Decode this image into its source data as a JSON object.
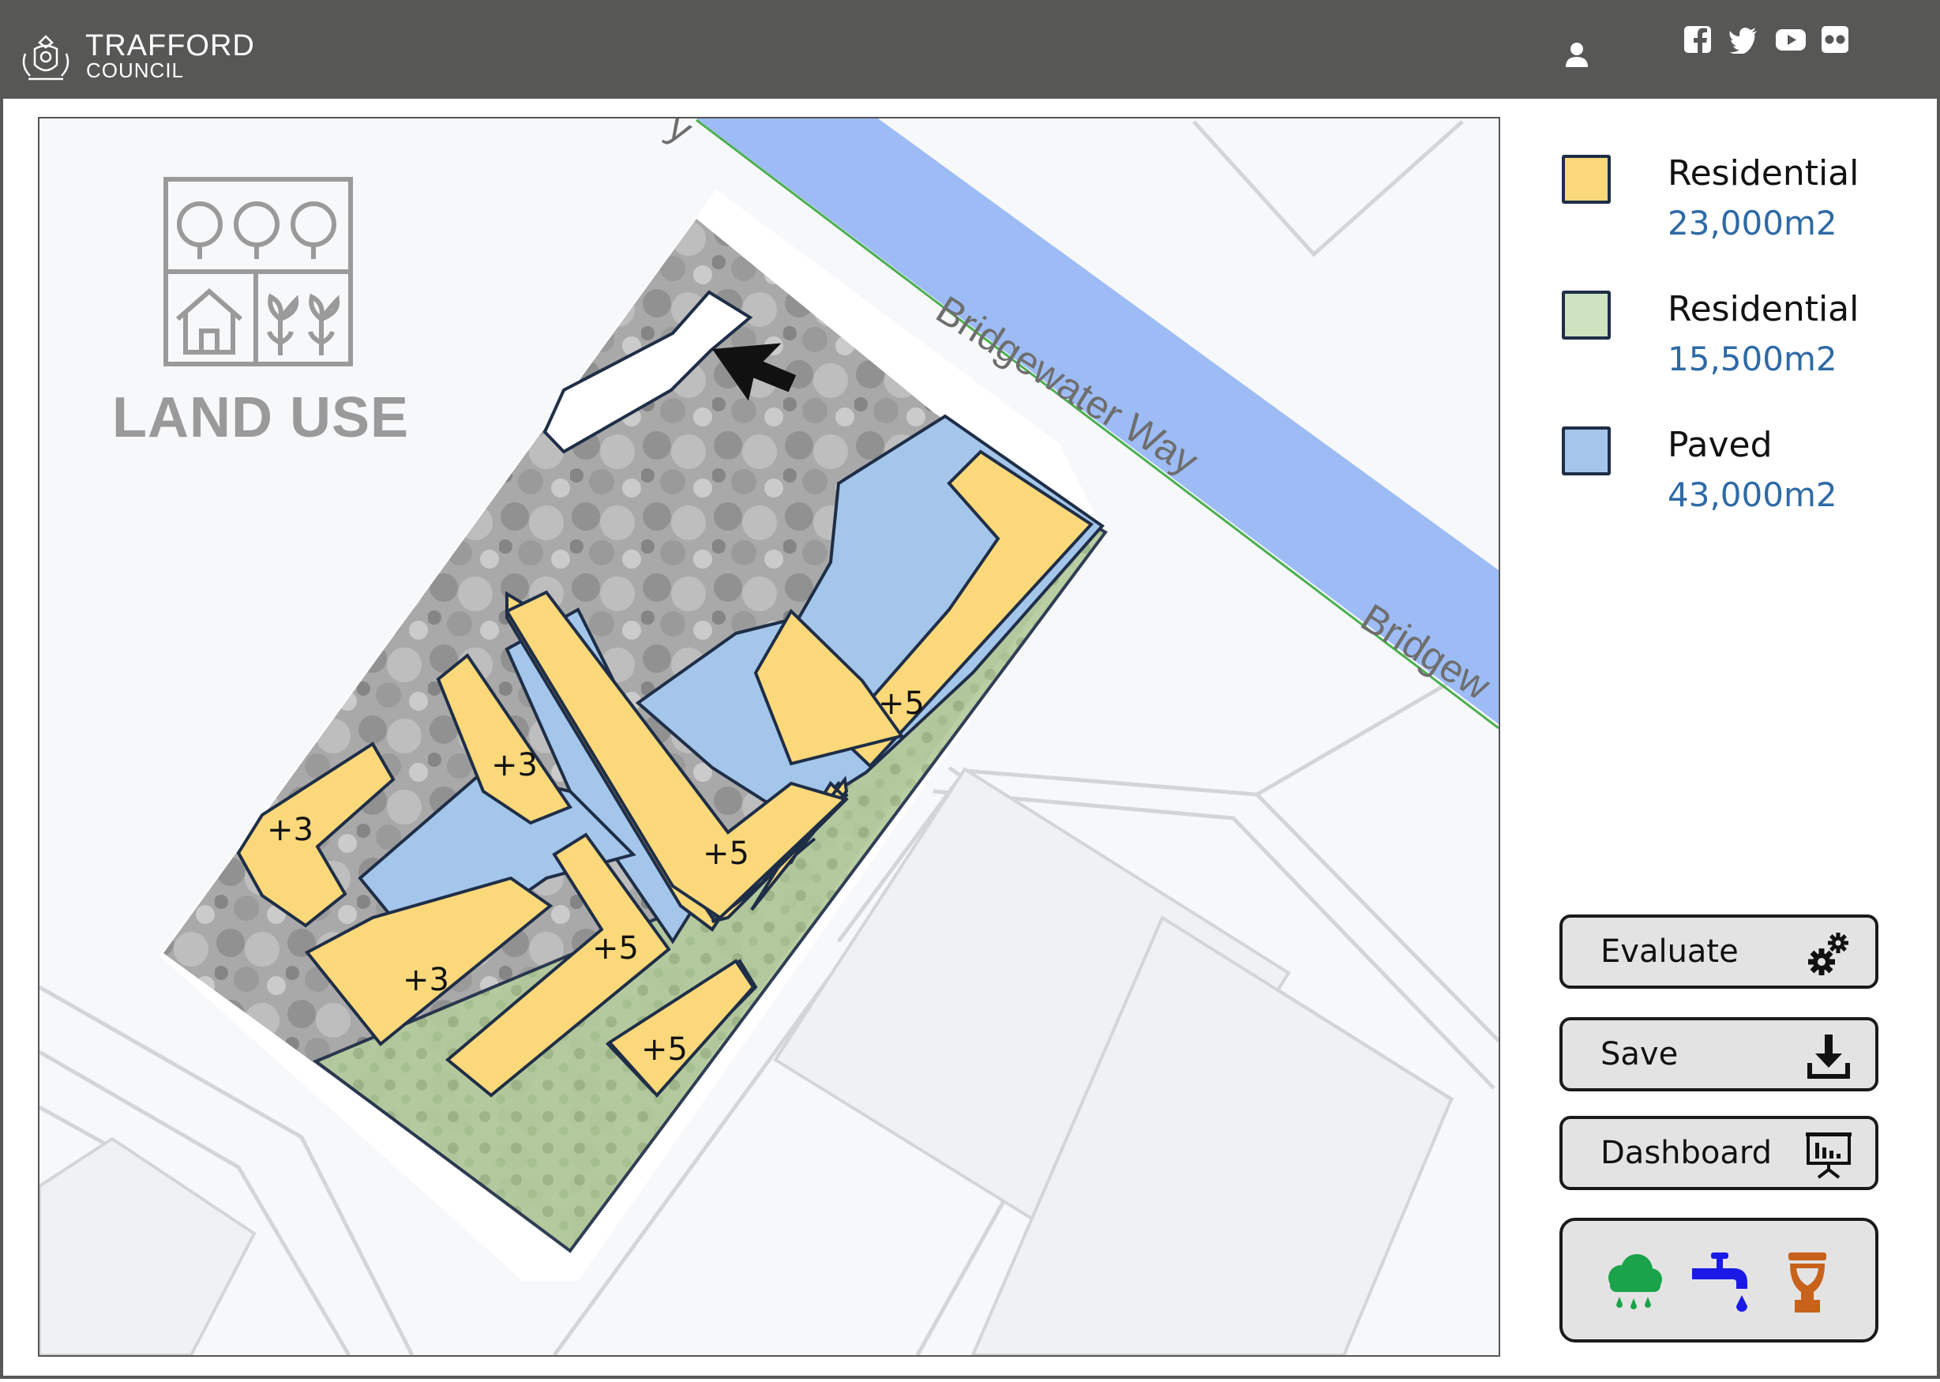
{
  "header": {
    "brand_line1": "TRAFFORD",
    "brand_line2": "COUNCIL",
    "social_icons": [
      "facebook-icon",
      "twitter-icon",
      "youtube-icon",
      "flickr-icon"
    ]
  },
  "map": {
    "title": "LAND USE",
    "street_label_1": "Bridgewater Way",
    "street_label_2": "Bridgew",
    "street_label_3": "y",
    "plot_labels": [
      "+3",
      "+3",
      "+3",
      "+5",
      "+5",
      "+5",
      "+5"
    ]
  },
  "legend": [
    {
      "label": "Residential",
      "value": "23,000m2",
      "color": "#fbd97a"
    },
    {
      "label": "Residential",
      "value": "15,500m2",
      "color": "#cfe3c0"
    },
    {
      "label": "Paved",
      "value": "43,000m2",
      "color": "#a4c6ea"
    }
  ],
  "buttons": {
    "evaluate": "Evaluate",
    "save": "Save",
    "dashboard": "Dashboard"
  },
  "tools": [
    "rain-cloud-icon",
    "water-tap-icon",
    "toilet-icon"
  ],
  "colors": {
    "header_bg": "#575756",
    "residential_yellow": "#fbd97a",
    "residential_green": "#cfe3c0",
    "paved_blue": "#a4c6ea",
    "canal_blue": "#9dbcf5",
    "value_blue": "#2e6aa6"
  }
}
